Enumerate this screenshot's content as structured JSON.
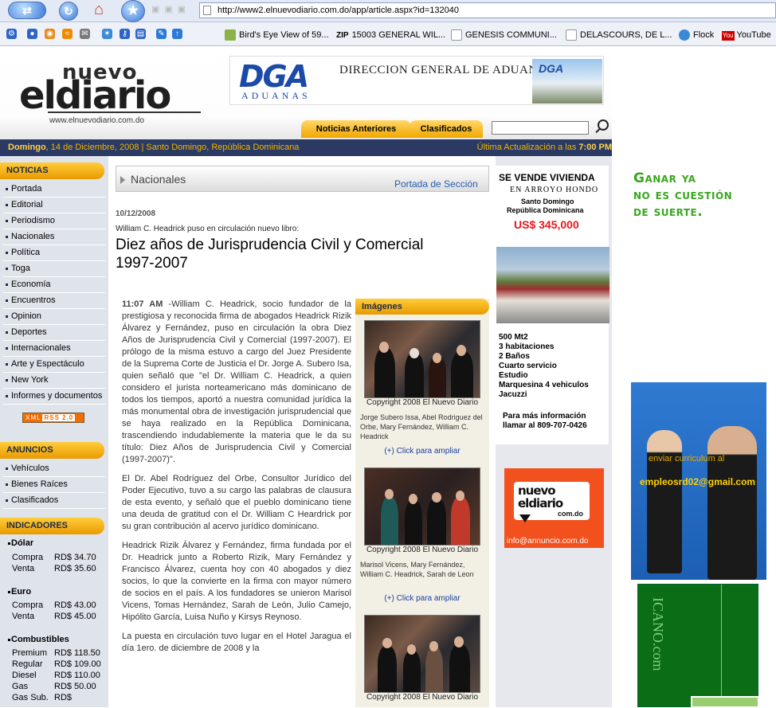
{
  "browser": {
    "url": "http://www2.elnuevodiario.com.do/app/article.aspx?id=132040",
    "bookmarks": [
      {
        "label": "Bird's Eye View of 59..."
      },
      {
        "label": "15003 GENERAL WIL..."
      },
      {
        "label": "GENESIS COMMUNI..."
      },
      {
        "label": "DELASCOURS, DE L..."
      },
      {
        "label": "Flock"
      },
      {
        "label": "YouTube"
      }
    ],
    "zip_label": "ZIP",
    "youtube_icon_label": "You"
  },
  "header": {
    "logo_top": "nuevo",
    "logo_main": "eldiario",
    "logo_url": "www.elnuevodiario.com.do",
    "banner": {
      "dga": "DGA",
      "aduanas": "ADUANAS",
      "title": "DIRECCION GENERAL DE ADUANAS",
      "photo_text": "DGA"
    },
    "tabs": [
      "Noticias Anteriores",
      "Clasificados"
    ],
    "search_placeholder": ""
  },
  "datebar": {
    "day": "Domingo",
    "date_rest": ", 14 de Diciembre, 2008 | Santo Domingo, República Dominicana",
    "update_label": "Última Actualización a las ",
    "update_time": "7:00 PM"
  },
  "sidebar": {
    "noticias_title": "NOTICIAS",
    "noticias": [
      "Portada",
      "Editorial",
      "Periodismo",
      "Nacionales",
      "Política",
      "Toga",
      "Economía",
      "Encuentros",
      "Opinion",
      "Deportes",
      "Internacionales",
      "Arte y Espectáculo",
      "New York",
      "Informes y documentos"
    ],
    "rss_label": "XML",
    "rss_version": "RSS 2.0",
    "anuncios_title": "ANUNCIOS",
    "anuncios": [
      "Vehículos",
      "Bienes Raíces",
      "Clasificados"
    ],
    "indicadores_title": "INDICADORES",
    "dolar": {
      "title": "Dólar",
      "compra_label": "Compra",
      "compra": "RD$ 34.70",
      "venta_label": "Venta",
      "venta": "RD$ 35.60"
    },
    "euro": {
      "title": "Euro",
      "compra_label": "Compra",
      "compra": "RD$ 43.00",
      "venta_label": "Venta",
      "venta": "RD$ 45.00"
    },
    "combustibles": {
      "title": "Combustibles",
      "items": [
        {
          "label": "Premium",
          "value": "RD$ 118.50"
        },
        {
          "label": "Regular",
          "value": "RD$ 109.00"
        },
        {
          "label": "Diesel",
          "value": "RD$ 110.00"
        },
        {
          "label": "Gas",
          "value": "RD$ 50.00"
        },
        {
          "label": "Gas Sub.",
          "value": "RD$"
        }
      ]
    }
  },
  "section": {
    "name": "Nacionales",
    "portada_link": "Portada de Sección"
  },
  "article": {
    "date": "10/12/2008",
    "kicker": "William C. Headrick puso en circulación nuevo libro:",
    "headline": "Diez años de Jurisprudencia Civil y Comercial 1997-2007",
    "time": "11:07 AM",
    "paragraphs": [
      " -William C. Headrick, socio fundador de la prestigiosa y reconocida firma de abogados Headrick Rizik Álvarez y Fernández, puso en circulación la obra Diez Años de Jurisprudencia Civil y Comercial (1997-2007).  El prólogo de la misma estuvo a cargo del  Juez Presidente de la  Suprema Corte de Justicia el Dr. Jorge A. Subero Isa, quien señaló que \"el Dr. William C.  Headrick, a quien considero el jurista norteamericano más dominicano de todos los tiempos, aportó a nuestra comunidad jurídica la más monumental obra de investigación jurisprudencial que se haya realizado en la República Dominicana, trascendiendo indudablemente la materia que le da su título: Diez Años de Jurisprudencia Civil y Comercial (1997-2007)\".",
      "El Dr. Abel Rodríguez del Orbe, Consultor Jurídico del Poder Ejecutivo, tuvo a su cargo las palabras de clausura de esta evento, y señaló que el pueblo dominicano tiene una deuda de gratitud con el Dr. William C Heardrick por su gran contribución al acervo jurídico dominicano.",
      "Headrick Rizik Álvarez y Fernández, firma fundada por el Dr. Headrick junto a Roberto Rizik, Mary Fernández y Francisco Álvarez, cuenta hoy con 40 abogados y diez socios, lo que la convierte en la firma con mayor número de socios en el país.  A los fundadores se unieron Marisol Vicens, Tomas Hernández, Sarah de León, Julio Camejo, Hipólito García, Luisa Nuño y Kirsys Reynoso.",
      "La puesta en circulación tuvo lugar en el Hotel Jaragua el día 1ero. de diciembre de 2008 y la"
    ]
  },
  "images": {
    "title": "Imágenes",
    "items": [
      {
        "copyright": "Copyright 2008 El Nuevo Diario",
        "caption": "Jorge Subero Issa, Abel Rodriguez del Orbe, Mary Fernández, William C. Headrick",
        "link": "(+) Click para ampliar"
      },
      {
        "copyright": "Copyright 2008 El Nuevo Diario",
        "caption": "Marisol Vicens, Mary Fernández, William C. Headrick, Sarah de Leon",
        "link": "(+) Click para ampliar"
      },
      {
        "copyright": "Copyright 2008 El Nuevo Diario",
        "caption": "",
        "link": ""
      }
    ]
  },
  "ads": {
    "vivienda": {
      "title": "SE VENDE VIVIENDA",
      "sub": "EN ARROYO HONDO",
      "city": "Santo Domingo",
      "country": "República Dominicana",
      "price": "US$ 345,000",
      "features": [
        "500 Mt2",
        "3 habitaciones",
        "2 Baños",
        "Cuarto servicio",
        "Estudio",
        "Marquesina 4 vehiculos",
        "Jacuzzi"
      ],
      "info1": "Para más información",
      "info2": "llamar al 809-707-0426"
    },
    "nuevodiario": {
      "logo": "nuevo eldiario",
      "dotcom": "com.do",
      "email": "info@annuncio.com.do"
    },
    "suerte": [
      "Ganar ya",
      "no es cuestión",
      "de suerte."
    ],
    "empleo": {
      "line1": "enviar curriculum al",
      "email": "empleosrd02@gmail.com"
    },
    "green_text": "ICANO.com"
  }
}
